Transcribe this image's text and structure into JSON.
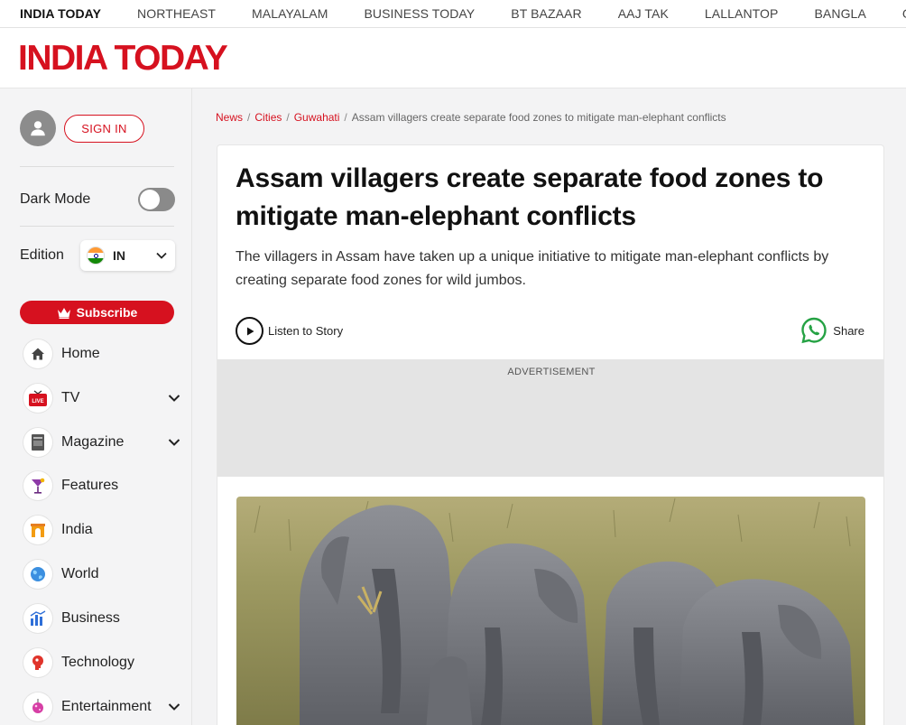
{
  "network_bar": {
    "items": [
      "INDIA TODAY",
      "NORTHEAST",
      "MALAYALAM",
      "BUSINESS TODAY",
      "BT BAZAAR",
      "AAJ TAK",
      "LALLANTOP",
      "BANGLA",
      "GNTTV"
    ]
  },
  "header": {
    "logo_text": "INDIA TODAY"
  },
  "sidebar": {
    "sign_in_label": "SIGN IN",
    "dark_mode_label": "Dark Mode",
    "dark_mode_on": false,
    "edition_label": "Edition",
    "edition_value": "IN",
    "subscribe_label": "Subscribe",
    "nav": [
      {
        "label": "Home",
        "icon": "home-icon",
        "has_submenu": false
      },
      {
        "label": "TV",
        "icon": "live-tv-icon",
        "has_submenu": true
      },
      {
        "label": "Magazine",
        "icon": "magazine-icon",
        "has_submenu": true
      },
      {
        "label": "Features",
        "icon": "cocktail-icon",
        "has_submenu": false
      },
      {
        "label": "India",
        "icon": "india-gate-icon",
        "has_submenu": false
      },
      {
        "label": "World",
        "icon": "globe-icon",
        "has_submenu": false
      },
      {
        "label": "Business",
        "icon": "bar-chart-icon",
        "has_submenu": false
      },
      {
        "label": "Technology",
        "icon": "brain-icon",
        "has_submenu": false
      },
      {
        "label": "Entertainment",
        "icon": "disco-ball-icon",
        "has_submenu": true
      }
    ]
  },
  "breadcrumb": {
    "links": [
      "News",
      "Cities",
      "Guwahati"
    ],
    "current": "Assam villagers create separate food zones to mitigate man-elephant conflicts"
  },
  "article": {
    "headline": "Assam villagers create separate food zones to mitigate man-elephant conflicts",
    "summary": "The villagers in Assam have taken up a unique initiative to mitigate man-elephant conflicts by creating separate food zones for wild jumbos.",
    "listen_label": "Listen to Story",
    "share_label": "Share",
    "ad_label": "ADVERTISEMENT"
  },
  "colors": {
    "brand_red": "#d6111f",
    "whatsapp_green": "#25a244"
  }
}
